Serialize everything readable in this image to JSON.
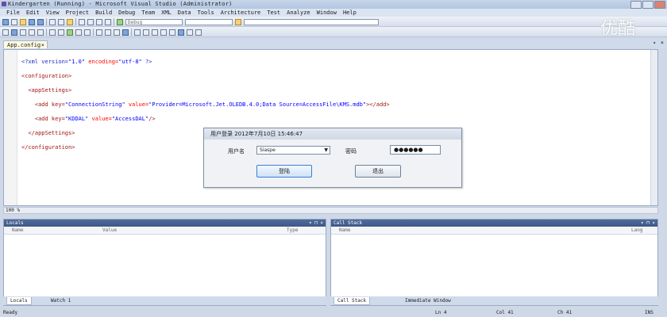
{
  "window": {
    "title": "Kindergarten (Running) - Microsoft Visual Studio (Administrator)"
  },
  "menubar": [
    "File",
    "Edit",
    "View",
    "Project",
    "Build",
    "Debug",
    "Team",
    "XML",
    "Data",
    "Tools",
    "Architecture",
    "Test",
    "Analyze",
    "Window",
    "Help"
  ],
  "toolbar": {
    "config_combo": "Debug"
  },
  "watermark": "优酷",
  "editor": {
    "tab_label": "App.config",
    "zoom": "100 %",
    "lines": [
      {
        "t1": "<?xml version=",
        "t2": "\"1.0\"",
        "t3": " encoding=",
        "t4": "\"utf-8\"",
        "t5": " ?>"
      },
      {
        "t1": "<configuration>"
      },
      {
        "t1": "  <appSettings>"
      },
      {
        "t1": "    <add key=",
        "t2": "\"ConnectionString\"",
        "t3": " value=",
        "t4": "\"Provider=Microsoft.Jet.OLEDB.4.0;Data Source=AccessFile\\KMS.mdb\"",
        "t5": "></add>"
      },
      {
        "t1": "    <add key=",
        "t2": "\"KDDAL\"",
        "t3": " value=",
        "t4": "\"AccessDAL\"",
        "t5": "/>"
      },
      {
        "t1": "  </appSettings>"
      },
      {
        "t1": "</configuration>"
      }
    ]
  },
  "dialog": {
    "title": "用户登录    2012年7月10日  15:46:47",
    "username_label": "用户名",
    "username_value": "Siaspe",
    "password_label": "密码",
    "password_value": "●●●●●●",
    "login_button": "登陆",
    "exit_button": "退出"
  },
  "locals_panel": {
    "title": "Locals",
    "columns": [
      "Name",
      "Value",
      "Type"
    ],
    "tabs": [
      "Locals",
      "Watch 1"
    ]
  },
  "callstack_panel": {
    "title": "Call Stack",
    "columns": [
      "Name",
      "Lang"
    ],
    "tabs": [
      "Call Stack",
      "Immediate Window"
    ]
  },
  "statusbar": {
    "state": "Ready",
    "ln": "Ln 4",
    "col": "Col 41",
    "ch": "Ch 41",
    "mode": "INS"
  }
}
